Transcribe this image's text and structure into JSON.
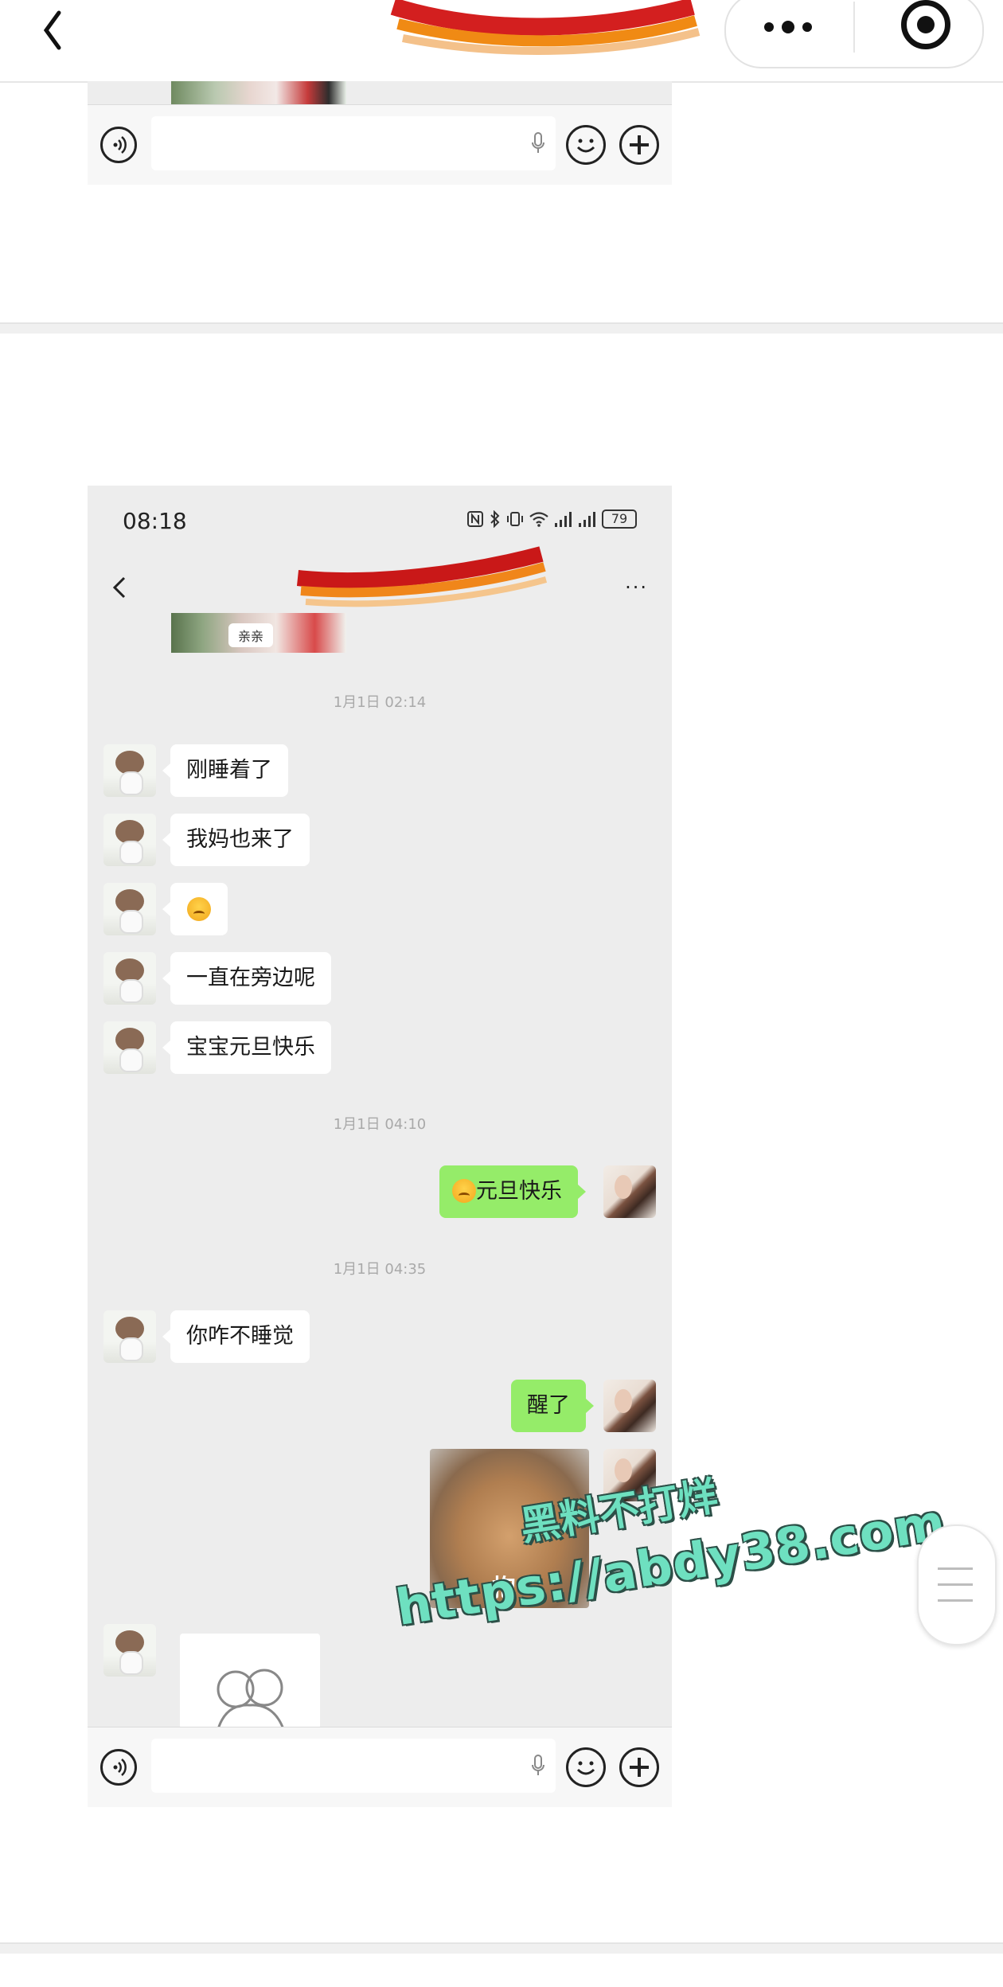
{
  "header": {
    "back_icon": "chevron-left-icon",
    "more_icon": "more-dots-icon",
    "close_icon": "target-close-icon"
  },
  "screenshot2": {
    "status_time": "08:18",
    "battery": "79",
    "photo_tag": "亲亲",
    "timestamps": [
      "1月1日 02:14",
      "1月1日 04:10",
      "1月1日 04:35"
    ],
    "incoming_1": [
      "刚睡着了",
      "我妈也来了",
      "一直在旁边呢",
      "宝宝元旦快乐"
    ],
    "outgoing_1": "元旦快乐",
    "incoming_2": "你咋不睡觉",
    "outgoing_2": "醒了",
    "sticker_text": "抱"
  },
  "watermark": {
    "line1": "黑料不打烊",
    "line2": "https://abdy38.com"
  },
  "colors": {
    "chat_bg": "#ededed",
    "outgoing_bubble": "#95ec69",
    "incoming_bubble": "#ffffff",
    "watermark": "#6ee0c0"
  }
}
